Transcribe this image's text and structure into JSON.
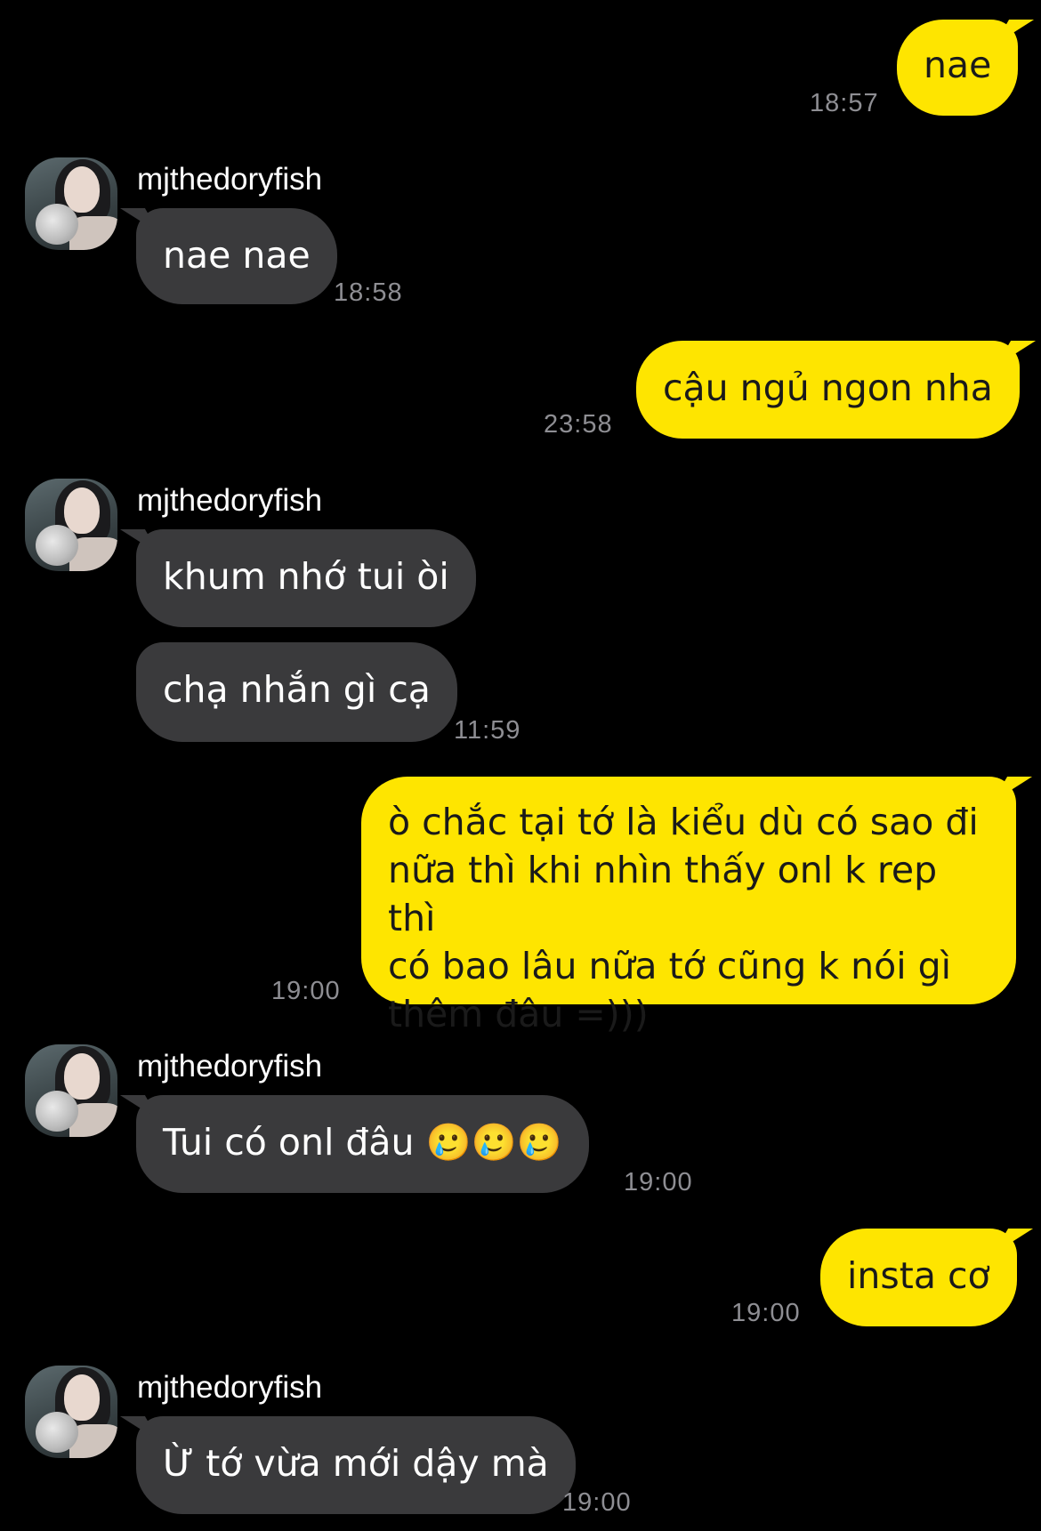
{
  "contact": {
    "name": "mjthedoryfish"
  },
  "colors": {
    "background": "#000000",
    "outgoing_bubble": "#FEE500",
    "incoming_bubble": "#3a3a3c",
    "timestamp": "#8e8e93"
  },
  "messages": [
    {
      "direction": "outgoing",
      "text": "nae",
      "time": "18:57"
    },
    {
      "direction": "incoming",
      "sender": "mjthedoryfish",
      "text": "nae nae",
      "time": "18:58"
    },
    {
      "direction": "outgoing",
      "text": "cậu ngủ ngon nha",
      "time": "23:58"
    },
    {
      "direction": "incoming",
      "sender": "mjthedoryfish",
      "text": "khum nhớ tui òi",
      "time": ""
    },
    {
      "direction": "incoming",
      "text": "chạ nhắn gì cạ",
      "time": "11:59"
    },
    {
      "direction": "outgoing",
      "lines": [
        "ò chắc tại tớ là kiểu dù có sao đi",
        "nữa thì khi nhìn thấy onl k rep thì",
        "có bao lâu nữa tớ cũng k nói gì",
        "thêm đâu =)))"
      ],
      "time": "19:00"
    },
    {
      "direction": "incoming",
      "sender": "mjthedoryfish",
      "text": "Tui có onl đâu 🥲🥲🥲",
      "time": "19:00"
    },
    {
      "direction": "outgoing",
      "text": "insta cơ",
      "time": "19:00"
    },
    {
      "direction": "incoming",
      "sender": "mjthedoryfish",
      "text": "Ừ tớ vừa mới dậy mà",
      "time": "19:00"
    }
  ]
}
